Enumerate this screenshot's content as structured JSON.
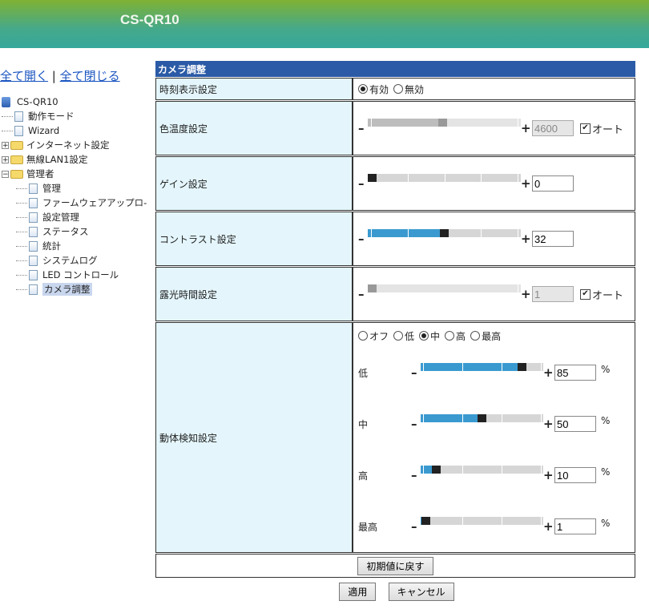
{
  "header": {
    "title": "CS-QR10"
  },
  "links": {
    "expand_all": "全て開く",
    "separator": "|",
    "collapse_all": "全て閉じる"
  },
  "tree": {
    "root": "CS-QR10",
    "items": [
      "動作モード",
      "Wizard"
    ],
    "folders": [
      {
        "label": "インターネット設定"
      },
      {
        "label": "無線LAN1設定"
      }
    ],
    "admin": {
      "label": "管理者",
      "children": [
        "管理",
        "ファームウェアアップロ-",
        "設定管理",
        "ステータス",
        "統計",
        "システムログ",
        "LED コントロール",
        "カメラ調整"
      ]
    }
  },
  "panel": {
    "title": "カメラ調整",
    "time_display": {
      "label": "時刻表示設定",
      "options": [
        "有効",
        "無効"
      ],
      "selected": 0
    },
    "color_temp": {
      "label": "色温度設定",
      "value": "4600",
      "position": 0.49,
      "auto_label": "オート",
      "auto": true,
      "disabled": true
    },
    "gain": {
      "label": "ゲイン設定",
      "value": "0",
      "position": 0
    },
    "contrast": {
      "label": "コントラスト設定",
      "value": "32",
      "position": 0.5
    },
    "exposure": {
      "label": "露光時間設定",
      "value": "1",
      "position": 0,
      "auto_label": "オート",
      "auto": true,
      "disabled": true
    },
    "motion": {
      "label": "動体検知設定",
      "options": [
        "オフ",
        "低",
        "中",
        "高",
        "最高"
      ],
      "selected": 2,
      "unit": "%",
      "levels": [
        {
          "label": "低",
          "value": "85",
          "position": 0.85
        },
        {
          "label": "中",
          "value": "50",
          "position": 0.5
        },
        {
          "label": "高",
          "value": "10",
          "position": 0.1
        },
        {
          "label": "最高",
          "value": "1",
          "position": 0.01
        }
      ]
    },
    "reset_label": "初期値に戻す"
  },
  "buttons": {
    "apply": "適用",
    "cancel": "キャンセル"
  },
  "symbols": {
    "minus": "–",
    "plus": "+",
    "check": "✔",
    "expand": "+",
    "collapse": "−"
  }
}
